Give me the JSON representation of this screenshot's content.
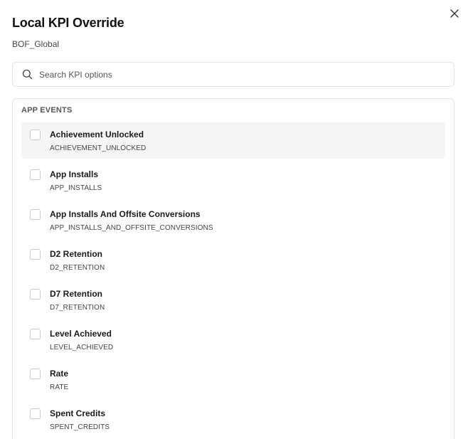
{
  "dialog": {
    "title": "Local KPI Override",
    "subtitle": "BOF_Global",
    "close_icon": "close-icon"
  },
  "search": {
    "placeholder": "Search KPI options",
    "value": "",
    "icon": "search-icon"
  },
  "groups": [
    {
      "header": "APP EVENTS",
      "items": [
        {
          "label": "Achievement Unlocked",
          "code": "ACHIEVEMENT_UNLOCKED",
          "checked": false
        },
        {
          "label": "App Installs",
          "code": "APP_INSTALLS",
          "checked": false
        },
        {
          "label": "App Installs And Offsite Conversions",
          "code": "APP_INSTALLS_AND_OFFSITE_CONVERSIONS",
          "checked": false
        },
        {
          "label": "D2 Retention",
          "code": "D2_RETENTION",
          "checked": false
        },
        {
          "label": "D7 Retention",
          "code": "D7_RETENTION",
          "checked": false
        },
        {
          "label": "Level Achieved",
          "code": "LEVEL_ACHIEVED",
          "checked": false
        },
        {
          "label": "Rate",
          "code": "RATE",
          "checked": false
        },
        {
          "label": "Spent Credits",
          "code": "SPENT_CREDITS",
          "checked": false
        }
      ]
    }
  ]
}
